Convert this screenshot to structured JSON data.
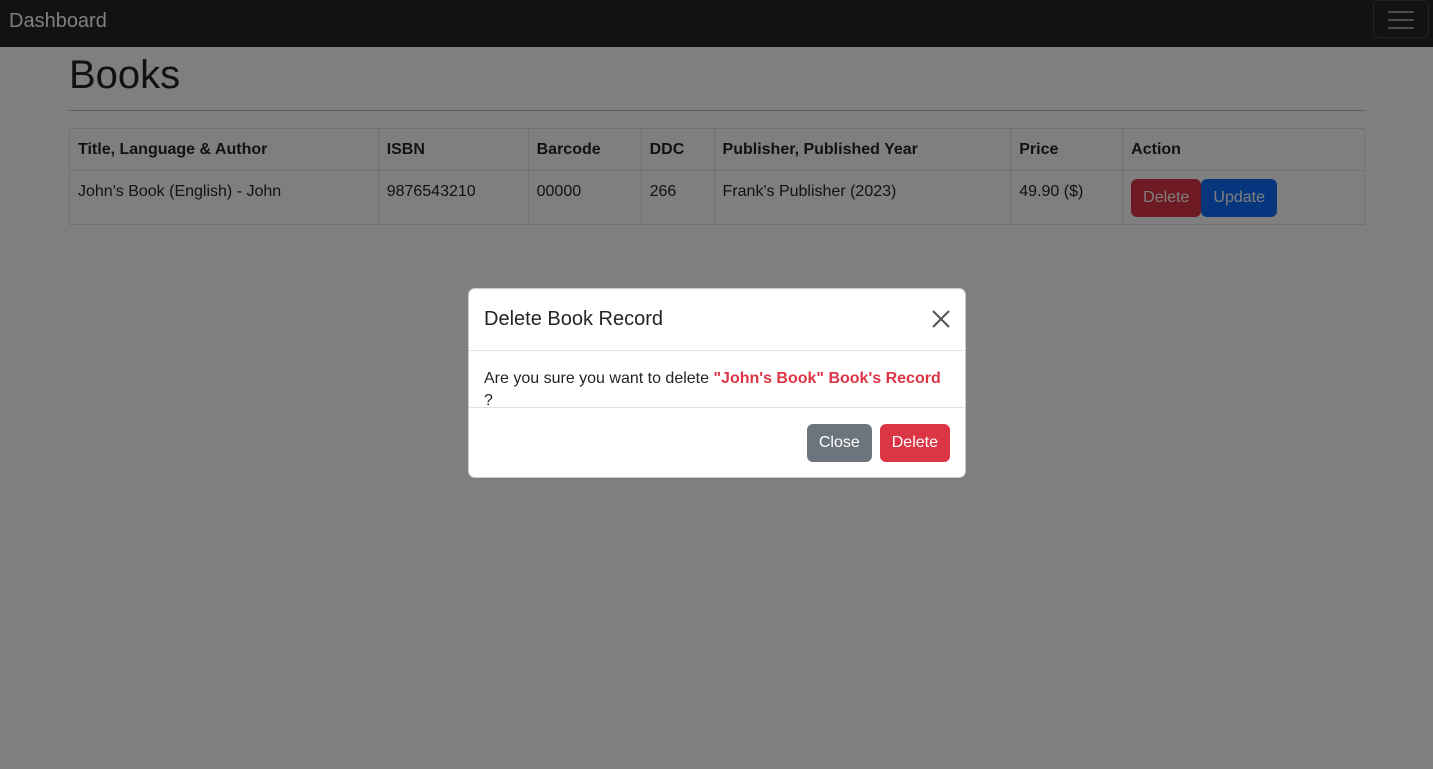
{
  "navbar": {
    "brand": "Dashboard",
    "toggler_icon": "hamburger-menu-icon"
  },
  "page": {
    "title": "Books"
  },
  "table": {
    "headers": [
      "Title, Language & Author",
      "ISBN",
      "Barcode",
      "DDC",
      "Publisher, Published Year",
      "Price",
      "Action"
    ],
    "rows": [
      {
        "title_lang_author": "John's Book (English) - John",
        "isbn": "9876543210",
        "barcode": "00000",
        "ddc": "266",
        "publisher_year": "Frank's Publisher (2023)",
        "price": "49.90 ($)",
        "delete_label": "Delete",
        "update_label": "Update"
      }
    ]
  },
  "modal": {
    "title": "Delete Book Record",
    "close_icon": "close-icon",
    "body_prefix": "Are you sure you want to delete ",
    "body_highlight": "\"John's Book\" Book's Record",
    "body_suffix": " ?",
    "close_label": "Close",
    "delete_label": "Delete"
  },
  "colors": {
    "navbar_bg": "#212529",
    "danger": "#dc3545",
    "primary": "#0d6efd",
    "secondary": "#6c757d",
    "backdrop": "rgba(0,0,0,0.5)"
  }
}
